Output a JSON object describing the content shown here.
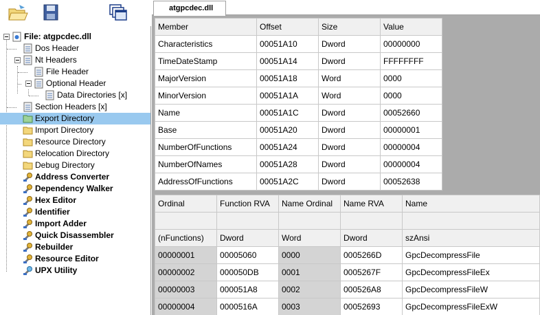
{
  "tab": {
    "label": "atgpcdec.dll"
  },
  "toolbar": {
    "buttons": [
      {
        "name": "open-icon"
      },
      {
        "name": "save-icon"
      },
      {
        "name": "windows-icon"
      }
    ]
  },
  "tree": {
    "items": [
      {
        "label": "File: atgpcdec.dll",
        "icon": "file-icon"
      },
      {
        "label": "Dos Header",
        "icon": "page-icon"
      },
      {
        "label": "Nt Headers",
        "icon": "page-icon"
      },
      {
        "label": "File Header",
        "icon": "page-icon"
      },
      {
        "label": "Optional Header",
        "icon": "page-icon"
      },
      {
        "label": "Data Directories [x]",
        "icon": "page-icon"
      },
      {
        "label": "Section Headers [x]",
        "icon": "page-icon"
      },
      {
        "label": "Export Directory",
        "icon": "folder-icon"
      },
      {
        "label": "Import Directory",
        "icon": "folder-icon"
      },
      {
        "label": "Resource Directory",
        "icon": "folder-icon"
      },
      {
        "label": "Relocation Directory",
        "icon": "folder-icon"
      },
      {
        "label": "Debug Directory",
        "icon": "folder-icon"
      },
      {
        "label": "Address Converter",
        "icon": "tool-icon"
      },
      {
        "label": "Dependency Walker",
        "icon": "tool-icon"
      },
      {
        "label": "Hex Editor",
        "icon": "tool-icon"
      },
      {
        "label": "Identifier",
        "icon": "tool-icon"
      },
      {
        "label": "Import Adder",
        "icon": "tool-icon"
      },
      {
        "label": "Quick Disassembler",
        "icon": "tool-icon"
      },
      {
        "label": "Rebuilder",
        "icon": "tool-icon"
      },
      {
        "label": "Resource Editor",
        "icon": "tool-icon"
      },
      {
        "label": "UPX Utility",
        "icon": "upx-icon"
      }
    ]
  },
  "header_table": {
    "columns": [
      "Member",
      "Offset",
      "Size",
      "Value"
    ],
    "rows": [
      [
        "Characteristics",
        "00051A10",
        "Dword",
        "00000000"
      ],
      [
        "TimeDateStamp",
        "00051A14",
        "Dword",
        "FFFFFFFF"
      ],
      [
        "MajorVersion",
        "00051A18",
        "Word",
        "0000"
      ],
      [
        "MinorVersion",
        "00051A1A",
        "Word",
        "0000"
      ],
      [
        "Name",
        "00051A1C",
        "Dword",
        "00052660"
      ],
      [
        "Base",
        "00051A20",
        "Dword",
        "00000001"
      ],
      [
        "NumberOfFunctions",
        "00051A24",
        "Dword",
        "00000004"
      ],
      [
        "NumberOfNames",
        "00051A28",
        "Dword",
        "00000004"
      ],
      [
        "AddressOfFunctions",
        "00051A2C",
        "Dword",
        "00052638"
      ]
    ]
  },
  "export_table": {
    "columns": [
      "Ordinal",
      "Function RVA",
      "Name Ordinal",
      "Name RVA",
      "Name"
    ],
    "types": [
      "(nFunctions)",
      "Dword",
      "Word",
      "Dword",
      "szAnsi"
    ],
    "rows": [
      [
        "00000001",
        "00005060",
        "0000",
        "0005266D",
        "GpcDecompressFile"
      ],
      [
        "00000002",
        "000050DB",
        "0001",
        "0005267F",
        "GpcDecompressFileEx"
      ],
      [
        "00000003",
        "000051A8",
        "0002",
        "000526A8",
        "GpcDecompressFileW"
      ],
      [
        "00000004",
        "0000516A",
        "0003",
        "00052693",
        "GpcDecompressFileExW"
      ]
    ]
  }
}
